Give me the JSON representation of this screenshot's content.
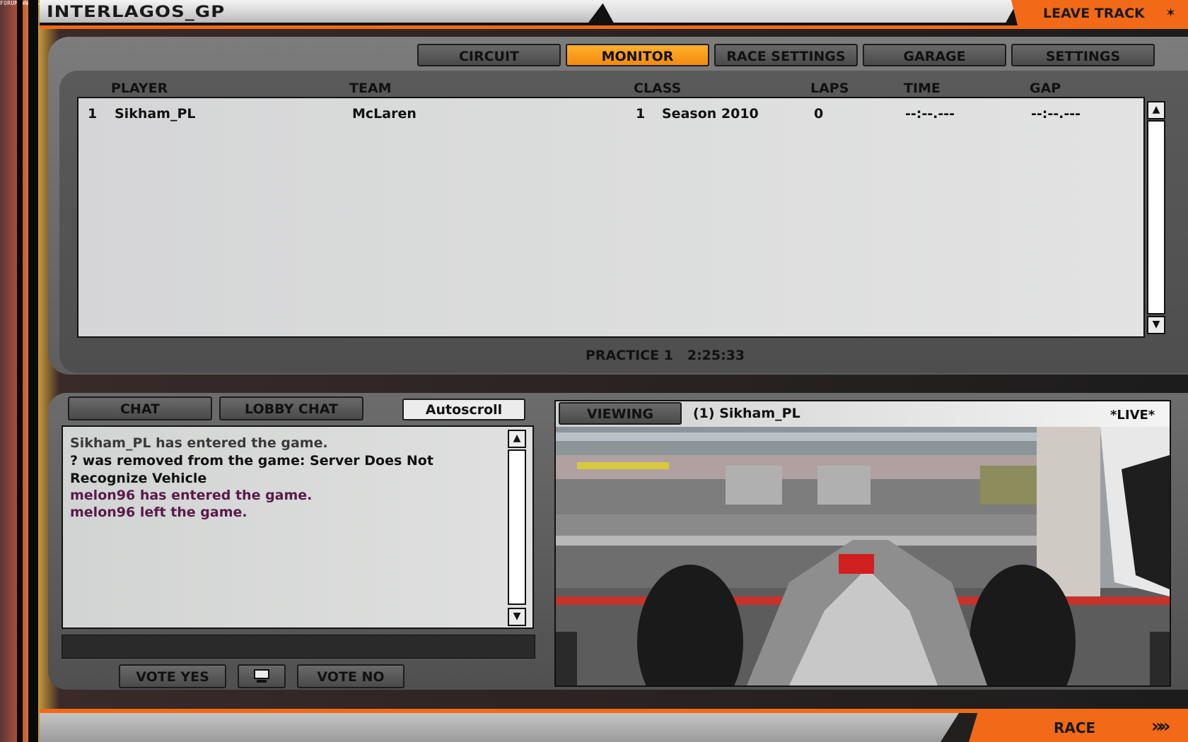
{
  "watermark": "FORUM WWW.GRY-ONLINE.PL",
  "header": {
    "track_name": "INTERLAGOS_GP",
    "leave_label": "LEAVE TRACK",
    "leave_icon": "✶"
  },
  "tabs": [
    {
      "label": "CIRCUIT",
      "active": false
    },
    {
      "label": "MONITOR",
      "active": true
    },
    {
      "label": "RACE SETTINGS",
      "active": false
    },
    {
      "label": "GARAGE",
      "active": false
    },
    {
      "label": "SETTINGS",
      "active": false
    }
  ],
  "standings": {
    "columns": [
      "PLAYER",
      "TEAM",
      "CLASS",
      "LAPS",
      "TIME",
      "GAP"
    ],
    "rows": [
      {
        "pos": "1",
        "player": "Sikham_PL",
        "team": "McLaren",
        "class_pos": "1",
        "class": "Season 2010",
        "laps": "0",
        "time": "--:--.---",
        "gap": "--:--.---"
      }
    ]
  },
  "session": {
    "name": "PRACTICE 1",
    "clock": "2:25:33"
  },
  "chat": {
    "tabs": [
      "CHAT",
      "LOBBY CHAT"
    ],
    "autoscroll_label": "Autoscroll",
    "messages": [
      {
        "text": "Sikham_PL has entered the game.",
        "color": "#3a3a3a"
      },
      {
        "text": "? was removed from the game: Server Does Not",
        "color": "#111111"
      },
      {
        "text": "Recognize Vehicle",
        "color": "#111111"
      },
      {
        "text": "melon96 has entered the game.",
        "color": "#5a1a4a"
      },
      {
        "text": "melon96 left the game.",
        "color": "#5a1a4a"
      }
    ],
    "input_value": ""
  },
  "vote": {
    "yes_label": "VOTE YES",
    "no_label": "VOTE NO",
    "middle_icon": "monitor-icon"
  },
  "viewport": {
    "viewing_label": "VIEWING",
    "driver": "(1) Sikham_PL",
    "status": "*LIVE*"
  },
  "footer": {
    "race_label": "RACE",
    "race_arrows": "»»"
  },
  "colors": {
    "accent": "#f26a17",
    "active_tab": "#ffb12e"
  }
}
